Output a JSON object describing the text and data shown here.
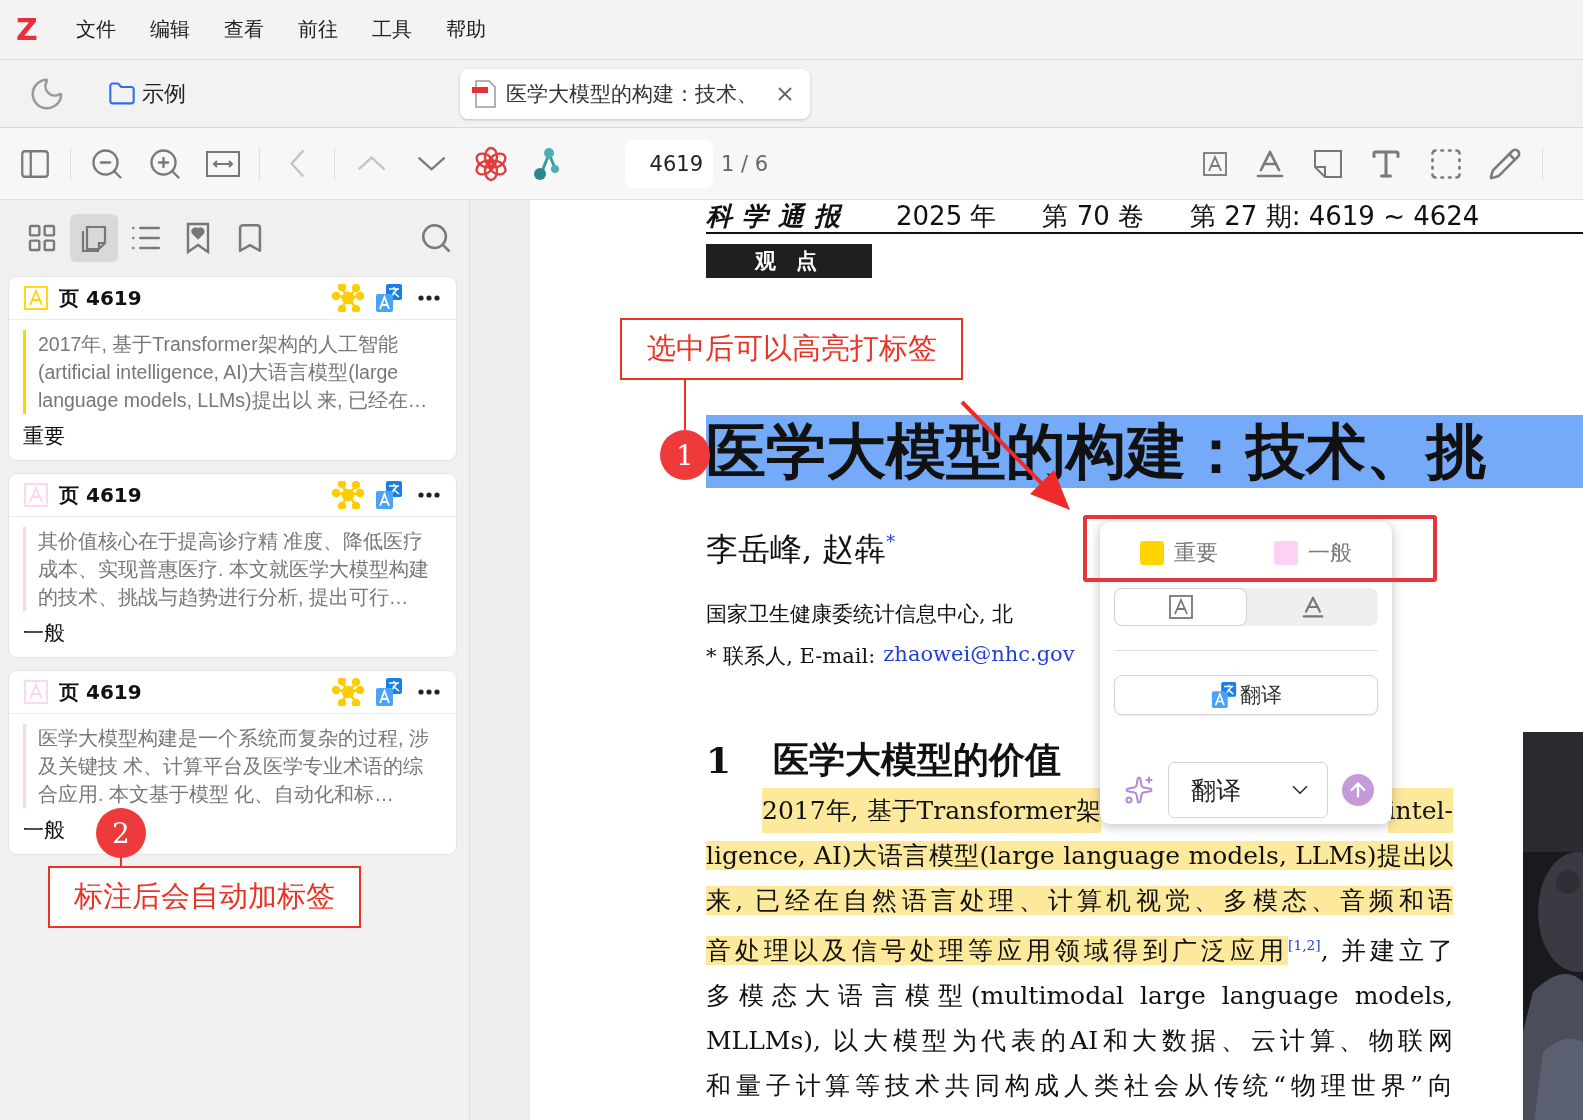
{
  "app": {
    "logo": "Z",
    "menu": [
      "文件",
      "编辑",
      "查看",
      "前往",
      "工具",
      "帮助"
    ]
  },
  "tabs": {
    "library": {
      "label": "示例"
    },
    "document": {
      "title": "医学大模型的构建：技术、"
    }
  },
  "toolbar": {
    "nav": [
      {
        "kind": "back",
        "disabled": true
      },
      {
        "kind": "up",
        "disabled": true
      },
      {
        "kind": "down",
        "disabled": false
      }
    ],
    "page": {
      "value": "4619"
    },
    "page_count": "1 / 6"
  },
  "sidebar": {
    "views": [
      {
        "kind": "thumbnails",
        "selected": false
      },
      {
        "kind": "annotations",
        "selected": true
      },
      {
        "kind": "outline",
        "selected": false
      },
      {
        "kind": "bookmarks",
        "selected": false
      },
      {
        "kind": "saved",
        "selected": false
      }
    ],
    "annotations": [
      {
        "color": "#ffd400",
        "page": "页 4619",
        "text": "2017年, 基于Transformer架构的人工智能(artificial intelligence, AI)大语言模型(large language models, LLMs)提出以 来, 已经在…",
        "tag": "重要"
      },
      {
        "color": "#fcd2f4",
        "page": "页 4619",
        "text": "其价值核心在于提高诊疗精 准度、降低医疗成本、实现普惠医疗. 本文就医学大模型构建的技术、挑战与趋势进行分析, 提出可行…",
        "tag": "一般"
      },
      {
        "color": "#fcd2f4",
        "page": "页 4619",
        "text": "医学大模型构建是一个系统而复杂的过程, 涉及关键技 术、计算平台及医学专业术语的综合应用. 本文基于模型 化、自动化和标…",
        "tag": "一般"
      }
    ]
  },
  "document": {
    "journal": "科学通报",
    "issue": [
      "2025 年",
      "第 70 卷",
      "第 27 期: 4619 ~ 4624"
    ],
    "column": "观 点",
    "title": {
      "text": "医学大模型的构建：技术、挑",
      "selected": true
    },
    "authors": "李岳峰, 赵犇$^{*}$",
    "affiliation": "国家卫生健康委统计信息中心, 北",
    "contact": {
      "label": "* 联系人, E-mail:",
      "email": "zhaowei@nhc.gov"
    },
    "section": {
      "number": "1",
      "title": "医学大模型的价值"
    },
    "lines": [
      {
        "segments": [
          {
            "text": "2017年, 基于Transformer架",
            "highlighted": true
          },
          {
            "text": "intel-",
            "highlighted": true
          }
        ]
      },
      {
        "segments": [
          {
            "text": "ligence, AI)大语言模型(large language models, LLMs)提出以",
            "highlighted": true
          }
        ]
      },
      {
        "segments": [
          {
            "text": "来, 已经在自然语言处理、计算机视觉、多模态、音频和语",
            "highlighted": true
          }
        ]
      },
      {
        "segments": [
          {
            "text": "音处理以及信号处理等应用领域得到广泛应用",
            "highlighted": true
          },
          {
            "text": "$^{[1,2]}$, 并建立了",
            "highlighted": false
          }
        ]
      },
      {
        "segments": [
          {
            "text": "多模态大语言模型(multimodal large language models,",
            "highlighted": false
          }
        ]
      },
      {
        "segments": [
          {
            "text": "MLLMs), 以大模型为代表的AI和大数据、云计算、物联网",
            "highlighted": false
          }
        ]
      },
      {
        "segments": [
          {
            "text": "和量子计算等技术共同构成人类社会从传统“物理世界”向",
            "highlighted": false
          }
        ]
      }
    ]
  },
  "popup": {
    "colors": [
      {
        "label": "重要",
        "color": "#ffd400"
      },
      {
        "label": "一般",
        "color": "#fcd2f4"
      }
    ],
    "modes": [
      {
        "kind": "highlight",
        "selected": true
      },
      {
        "kind": "underline",
        "selected": false
      }
    ],
    "translate": "翻译",
    "action": {
      "value": "翻译"
    }
  },
  "callouts": [
    {
      "number": "1",
      "text": "选中后可以高亮打标签"
    },
    {
      "number": "2",
      "text": "标注后会自动加标签"
    }
  ]
}
